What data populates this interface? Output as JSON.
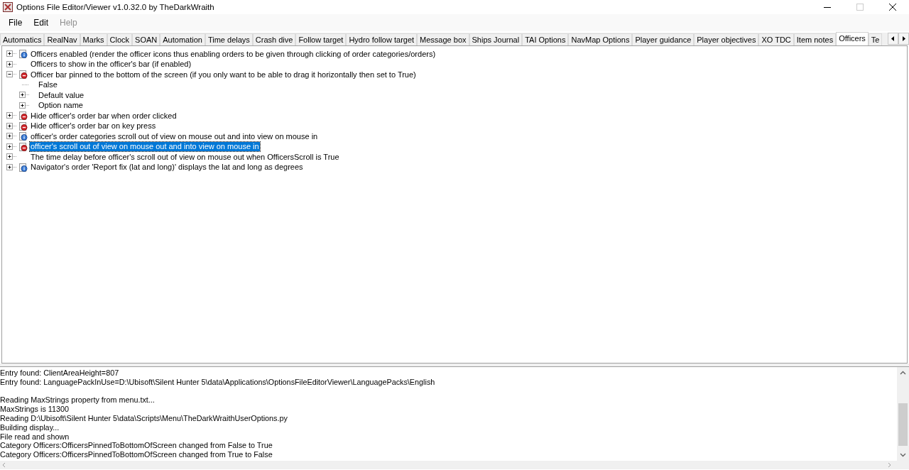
{
  "window": {
    "title": "Options File Editor/Viewer v1.0.32.0 by TheDarkWraith"
  },
  "menu": [
    {
      "label": "File",
      "disabled": false
    },
    {
      "label": "Edit",
      "disabled": false
    },
    {
      "label": "Help",
      "disabled": true
    }
  ],
  "tabs": [
    {
      "label": "Automatics",
      "selected": false
    },
    {
      "label": "RealNav",
      "selected": false
    },
    {
      "label": "Marks",
      "selected": false
    },
    {
      "label": "Clock",
      "selected": false
    },
    {
      "label": "SOAN",
      "selected": false
    },
    {
      "label": "Automation",
      "selected": false
    },
    {
      "label": "Time delays",
      "selected": false
    },
    {
      "label": "Crash dive",
      "selected": false
    },
    {
      "label": "Follow target",
      "selected": false
    },
    {
      "label": "Hydro follow target",
      "selected": false
    },
    {
      "label": "Message box",
      "selected": false
    },
    {
      "label": "Ships Journal",
      "selected": false
    },
    {
      "label": "TAI Options",
      "selected": false
    },
    {
      "label": "NavMap Options",
      "selected": false
    },
    {
      "label": "Player guidance",
      "selected": false
    },
    {
      "label": "Player objectives",
      "selected": false
    },
    {
      "label": "XO TDC",
      "selected": false
    },
    {
      "label": "Item notes",
      "selected": false
    },
    {
      "label": "Officers",
      "selected": true
    },
    {
      "label": "Te",
      "selected": false
    }
  ],
  "tree": [
    {
      "label": "Officers enabled (render the officer icons thus enabling orders to be given through clicking of order categories/orders)",
      "kind": "info",
      "expanded": false,
      "selected": false
    },
    {
      "label": "Officers to show in the officer's bar (if enabled)",
      "kind": "plain",
      "expanded": false,
      "selected": false
    },
    {
      "label": "Officer bar pinned to the bottom of the screen (if you only want to be able to drag it horizontally then set to True)",
      "kind": "stop",
      "expanded": true,
      "selected": false,
      "children": [
        {
          "label": "False",
          "leaf": true
        },
        {
          "label": "Default value",
          "leaf": false
        },
        {
          "label": "Option name",
          "leaf": false
        }
      ]
    },
    {
      "label": "Hide officer's order bar when order clicked",
      "kind": "stop",
      "expanded": false,
      "selected": false
    },
    {
      "label": "Hide officer's order bar on key press",
      "kind": "stop",
      "expanded": false,
      "selected": false
    },
    {
      "label": "officer's order categories scroll out of view on mouse out and into view on mouse in",
      "kind": "info",
      "expanded": false,
      "selected": false
    },
    {
      "label": "officer's scroll out of view on mouse out and into view on mouse in",
      "kind": "stop",
      "expanded": false,
      "selected": true
    },
    {
      "label": "The time delay before officer's scroll out of view on mouse out when OfficersScroll is True",
      "kind": "plain",
      "expanded": false,
      "selected": false
    },
    {
      "label": "Navigator's order 'Report fix (lat and long)' displays the lat and long as degrees",
      "kind": "info",
      "expanded": false,
      "selected": false
    }
  ],
  "log_blocks": [
    [
      "Entry found: ClientAreaHeight=807",
      "Entry found: LanguagePackInUse=D:\\Ubisoft\\Silent Hunter 5\\data\\Applications\\OptionsFileEditorViewer\\LanguagePacks\\English"
    ],
    [
      "Reading MaxStrings property from menu.txt...",
      "MaxStrings is 11300",
      "Reading D:\\Ubisoft\\Silent Hunter 5\\data\\Scripts\\Menu\\TheDarkWraithUserOptions.py",
      "Building display...",
      "File read and shown",
      "Category Officers:OfficersPinnedToBottomOfScreen changed from False to True",
      "Category Officers:OfficersPinnedToBottomOfScreen changed from True to False"
    ]
  ]
}
